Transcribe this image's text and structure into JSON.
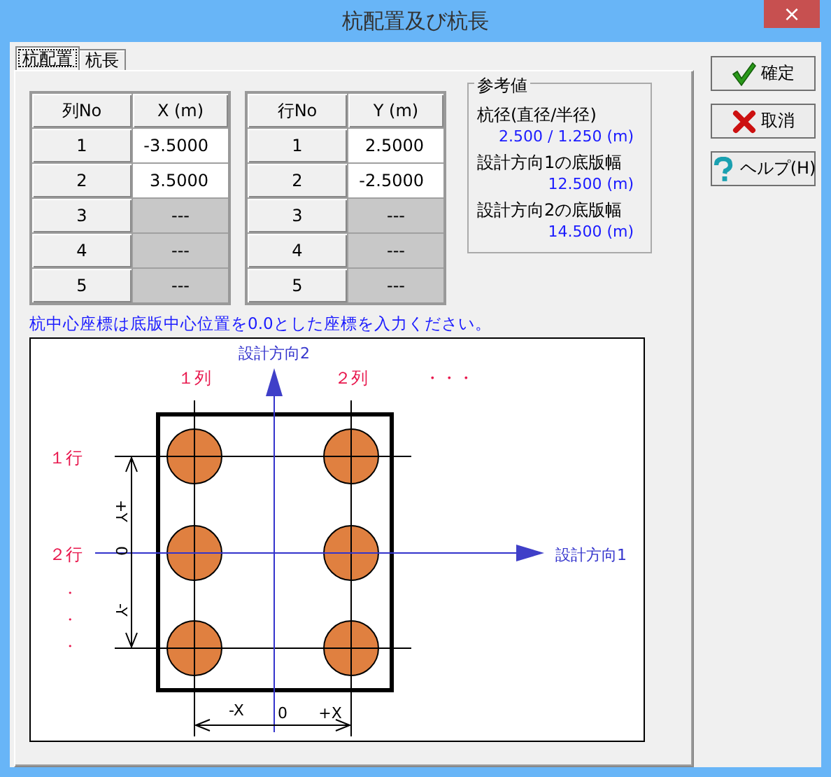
{
  "window": {
    "title": "杭配置及び杭長",
    "close": "×"
  },
  "tabs": [
    {
      "label": "杭配置",
      "selected": true
    },
    {
      "label": "杭長",
      "selected": false
    }
  ],
  "tables": [
    {
      "columns": [
        "列No",
        "X (m)"
      ],
      "rows": [
        {
          "no": "1",
          "value": "-3.5000",
          "disabled": false
        },
        {
          "no": "2",
          "value": "3.5000",
          "disabled": false
        },
        {
          "no": "3",
          "value": "---",
          "disabled": true
        },
        {
          "no": "4",
          "value": "---",
          "disabled": true
        },
        {
          "no": "5",
          "value": "---",
          "disabled": true
        }
      ]
    },
    {
      "columns": [
        "行No",
        "Y (m)"
      ],
      "rows": [
        {
          "no": "1",
          "value": "2.5000",
          "disabled": false
        },
        {
          "no": "2",
          "value": "-2.5000",
          "disabled": false
        },
        {
          "no": "3",
          "value": "---",
          "disabled": true
        },
        {
          "no": "4",
          "value": "---",
          "disabled": true
        },
        {
          "no": "5",
          "value": "---",
          "disabled": true
        }
      ]
    }
  ],
  "reference": {
    "title": "参考値",
    "items": [
      {
        "label": "杭径(直径/半径)",
        "value": "2.500 / 1.250 (m)"
      },
      {
        "label": "設計方向1の底版幅",
        "value": "12.500 (m)"
      },
      {
        "label": "設計方向2の底版幅",
        "value": "14.500 (m)"
      }
    ]
  },
  "note": "杭中心座標は底版中心位置を0.0とした座標を入力ください。",
  "diagram": {
    "axis_labels": [
      "設計方向2",
      "設計方向1"
    ],
    "column_labels": [
      "１列",
      "２列",
      "・・・"
    ],
    "row_labels": [
      "１行",
      "２行",
      "・",
      "・",
      "・"
    ],
    "y_dimension": [
      "+Y",
      "0",
      "-Y"
    ],
    "x_dimension": [
      "-X",
      "0",
      "+X"
    ]
  },
  "buttons": [
    {
      "label": "確定",
      "kind": "ok"
    },
    {
      "label": "取消",
      "kind": "cancel"
    },
    {
      "label": "ヘルプ(H)",
      "kind": "help"
    }
  ]
}
